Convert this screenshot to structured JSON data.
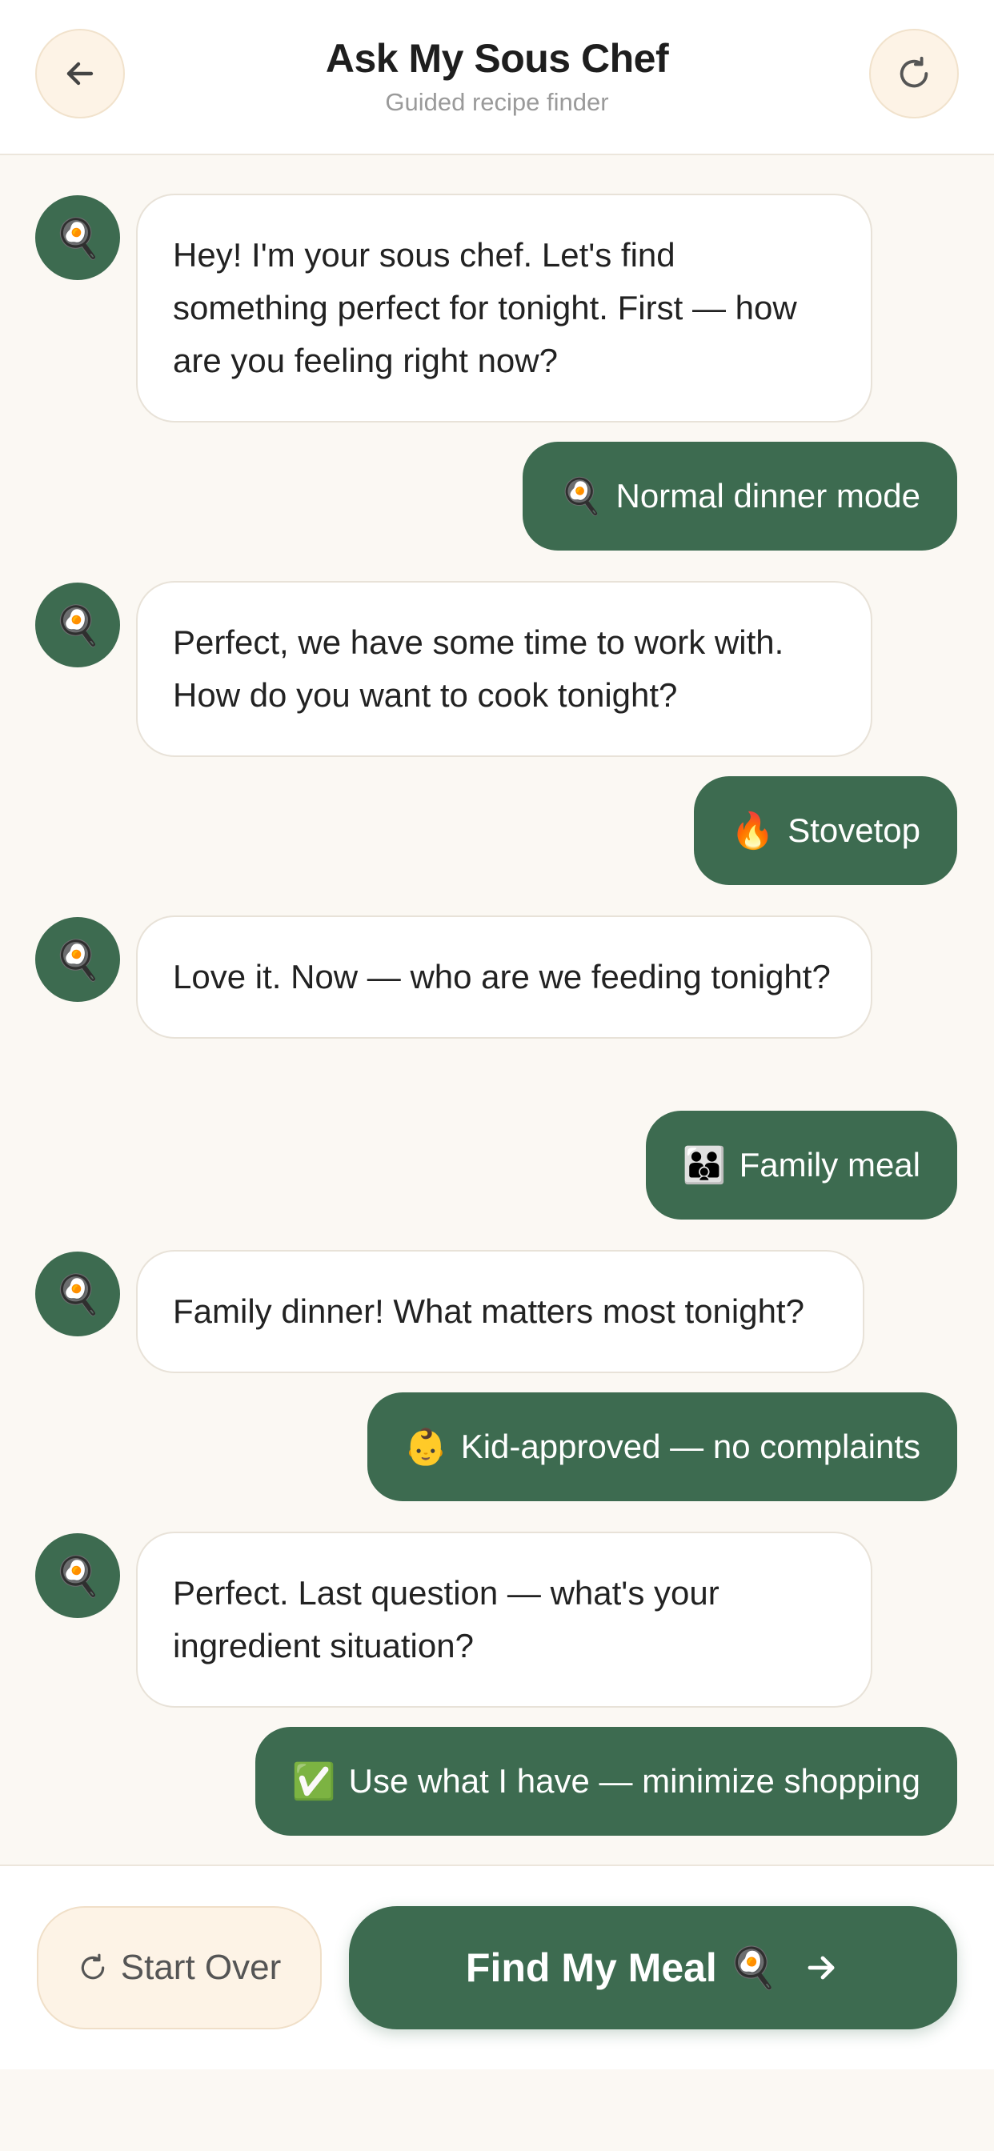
{
  "header": {
    "title": "Ask My Sous Chef",
    "subtitle": "Guided recipe finder",
    "back_icon": "arrow-left-icon",
    "refresh_icon": "refresh-icon"
  },
  "chat": {
    "bot_avatar_emoji": "🍳",
    "messages": [
      {
        "from": "bot",
        "text": "Hey! I'm your sous chef. Let's find something perfect for tonight. First — how are you feeling right now?"
      },
      {
        "from": "user",
        "emoji": "🍳",
        "text": "Normal dinner mode"
      },
      {
        "from": "bot",
        "text": "Perfect, we have some time to work with. How do you want to cook tonight?"
      },
      {
        "from": "user",
        "emoji": "🔥",
        "text": "Stovetop"
      },
      {
        "from": "bot",
        "text": "Love it. Now — who are we feeding tonight?"
      },
      {
        "from": "user",
        "emoji": "👪",
        "text": "Family meal"
      },
      {
        "from": "bot",
        "text": "Family dinner! What matters most tonight?"
      },
      {
        "from": "user",
        "emoji": "👶",
        "text": "Kid-approved — no complaints"
      },
      {
        "from": "bot",
        "text": "Perfect. Last question — what's your ingredient situation?"
      },
      {
        "from": "user",
        "emoji": "✅",
        "text": "Use what I have — minimize shopping"
      }
    ]
  },
  "footer": {
    "start_over_label": "Start Over",
    "find_meal_label": "Find My Meal",
    "find_meal_emoji": "🍳"
  },
  "colors": {
    "accent_green": "#3d6b50",
    "background": "#fbf8f3",
    "soft_cream": "#fdf3e6"
  }
}
